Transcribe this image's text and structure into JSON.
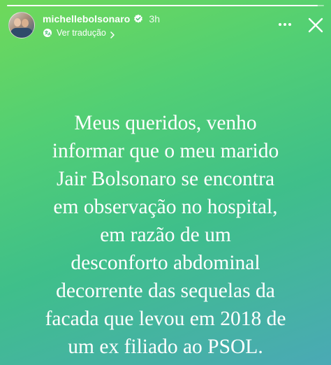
{
  "story": {
    "progress": 0.98,
    "gradient_colors": [
      "#6fd95a",
      "#52cf74",
      "#3fbf8a",
      "#4aa9b5"
    ]
  },
  "header": {
    "username": "michellebolsonaro",
    "verified_icon": "verified-badge-icon",
    "time": "3h",
    "translate_icon": "translate-icon",
    "translate_label": "Ver tradução",
    "translate_chevron": "chevron-right-icon",
    "more_icon": "more-horizontal-icon",
    "close_icon": "close-icon"
  },
  "text_lines": [
    "Meus queridos, venho",
    "informar que o meu marido",
    "Jair Bolsonaro se encontra",
    "em observação no hospital,",
    "em razão de um",
    "desconforto abdominal",
    "decorrente das sequelas da",
    "facada que levou em 2018 de",
    "um ex filiado ao PSOL."
  ]
}
